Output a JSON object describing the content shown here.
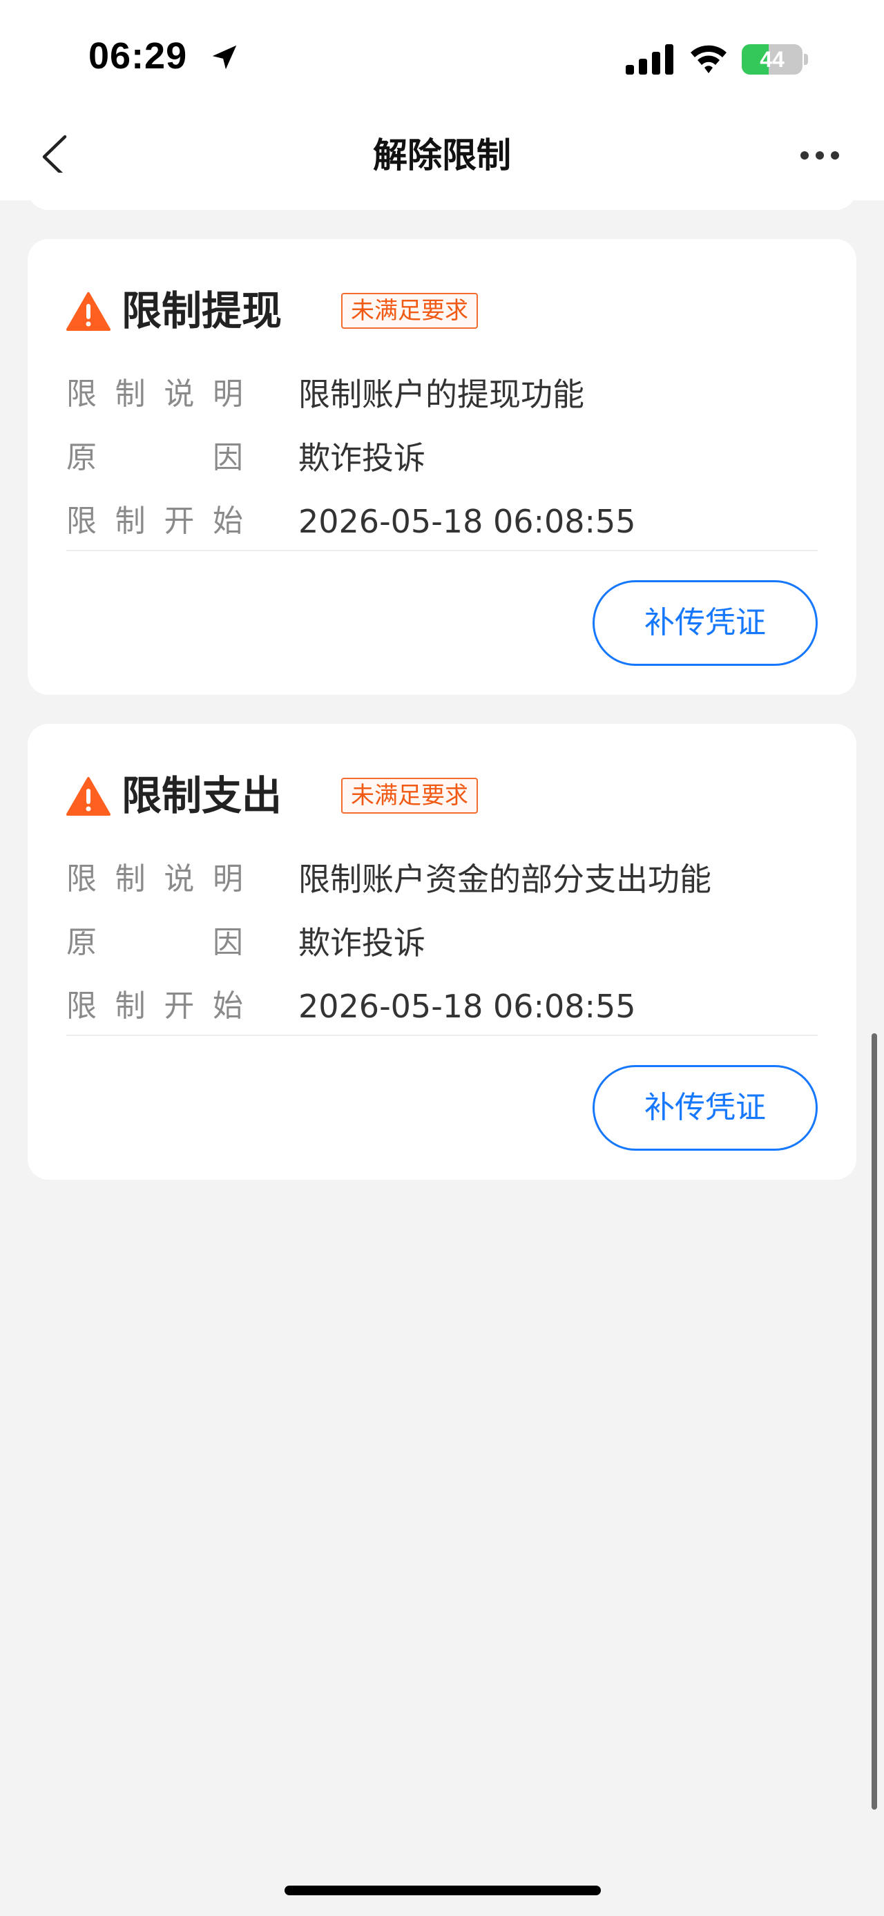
{
  "status_bar": {
    "time": "06:29",
    "battery_level": "44",
    "battery_fraction": 0.44,
    "location_icon": "location-arrow-icon",
    "signal_icon": "cellular-signal-icon",
    "wifi_icon": "wifi-icon"
  },
  "nav": {
    "title": "解除限制",
    "back_icon": "chevron-left-icon",
    "more_icon": "more-dots-icon"
  },
  "cards": [
    {
      "title": "限制提现",
      "status": "未满足要求",
      "rows": [
        {
          "label": [
            "限",
            "制",
            "说",
            "明"
          ],
          "value": "限制账户的提现功能"
        },
        {
          "label": [
            "原",
            "因"
          ],
          "value": "欺诈投诉"
        },
        {
          "label": [
            "限",
            "制",
            "开",
            "始"
          ],
          "value": "2026-05-18 06:08:55"
        }
      ],
      "button": "补传凭证"
    },
    {
      "title": "限制支出",
      "status": "未满足要求",
      "rows": [
        {
          "label": [
            "限",
            "制",
            "说",
            "明"
          ],
          "value": "限制账户资金的部分支出功能"
        },
        {
          "label": [
            "原",
            "因"
          ],
          "value": "欺诈投诉"
        },
        {
          "label": [
            "限",
            "制",
            "开",
            "始"
          ],
          "value": "2026-05-18 06:08:55"
        }
      ],
      "button": "补传凭证"
    }
  ],
  "colors": {
    "accent_blue": "#1677ff",
    "warning_orange": "#ff5f1f",
    "tag_orange": "#f05a14",
    "page_bg": "#f3f3f3",
    "card_bg": "#ffffff"
  }
}
